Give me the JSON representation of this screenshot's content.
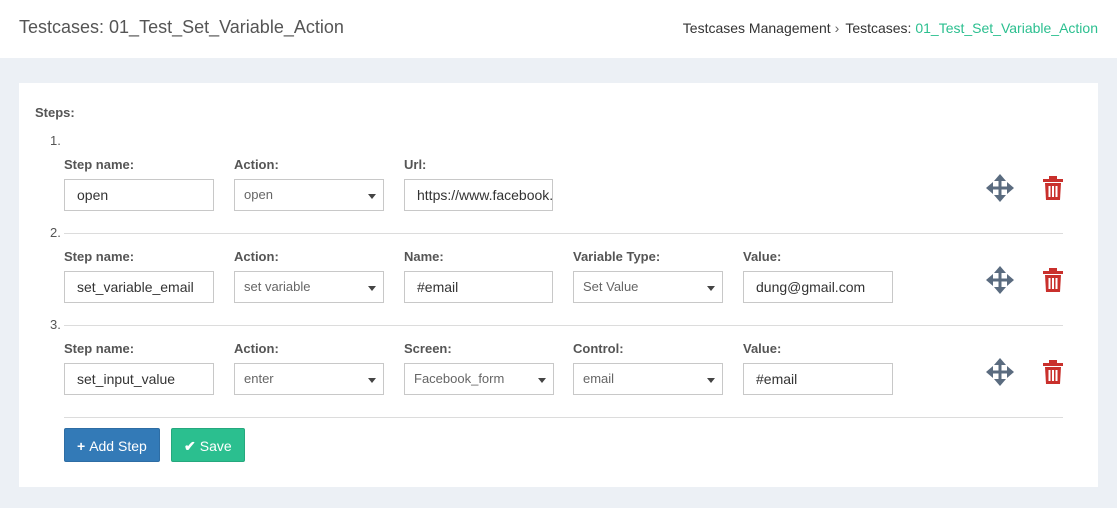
{
  "header": {
    "title": "Testcases: 01_Test_Set_Variable_Action",
    "breadcrumb": {
      "root": "Testcases Management",
      "separator": "›",
      "prefix": "Testcases:",
      "current": "01_Test_Set_Variable_Action"
    }
  },
  "steps_label": "Steps:",
  "steps": [
    {
      "number": "1.",
      "step_name_label": "Step name:",
      "step_name": "open",
      "action_label": "Action:",
      "action": "open",
      "field3_label": "Url:",
      "field3_value": "https://www.facebook.com"
    },
    {
      "number": "2.",
      "step_name_label": "Step name:",
      "step_name": "set_variable_email",
      "action_label": "Action:",
      "action": "set variable",
      "field3_label": "Name:",
      "field3_value": "#email",
      "field4_label": "Variable Type:",
      "field4_value": "Set Value",
      "field5_label": "Value:",
      "field5_value": "dung@gmail.com"
    },
    {
      "number": "3.",
      "step_name_label": "Step name:",
      "step_name": "set_input_value",
      "action_label": "Action:",
      "action": "enter",
      "field3_label": "Screen:",
      "field3_value": "Facebook_form",
      "field4_label": "Control:",
      "field4_value": "email",
      "field5_label": "Value:",
      "field5_value": "#email"
    }
  ],
  "buttons": {
    "add_step_icon": "+",
    "add_step": "Add Step",
    "save_icon": "✔",
    "save": "Save"
  },
  "icons": {
    "move": "move-arrows-icon",
    "delete": "trash-icon"
  },
  "colors": {
    "accent_green": "#2bbf8f",
    "primary_blue": "#337ab7",
    "delete_red": "#c9302c",
    "move_gray": "#5a6b7f"
  }
}
